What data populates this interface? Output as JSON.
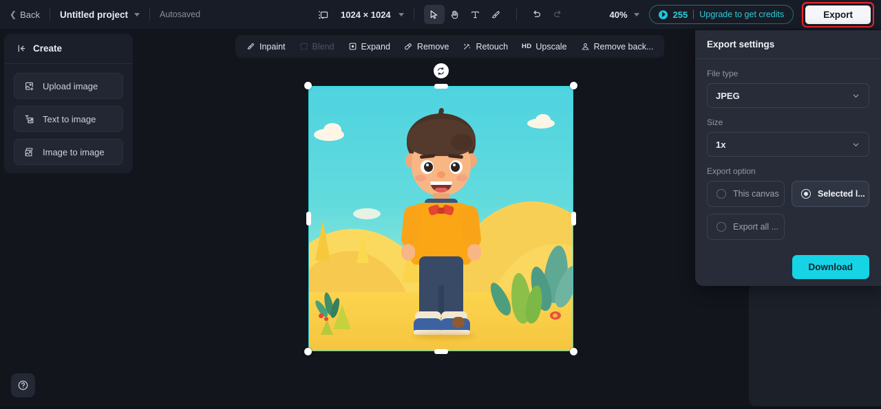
{
  "topbar": {
    "back_label": "Back",
    "back_icon": "chevron-left-icon",
    "project_name": "Untitled project",
    "project_caret_icon": "chevron-down-icon",
    "autosaved_label": "Autosaved",
    "canvas_icon": "canvas-frame-icon",
    "canvas_dimensions": "1024 × 1024",
    "dimensions_caret_icon": "chevron-down-icon",
    "tools": [
      {
        "name": "select-tool",
        "icon": "cursor-arrow-icon",
        "selected": true
      },
      {
        "name": "hand-tool",
        "icon": "hand-icon",
        "selected": false
      },
      {
        "name": "text-tool",
        "icon": "text-t-icon",
        "selected": false
      },
      {
        "name": "brush-tool",
        "icon": "brush-icon",
        "selected": false
      },
      {
        "name": "undo-tool",
        "icon": "undo-arrow-icon",
        "selected": false
      },
      {
        "name": "redo-tool",
        "icon": "redo-arrow-icon",
        "selected": false
      }
    ],
    "zoom_level": "40%",
    "zoom_caret_icon": "chevron-down-icon",
    "credits_count": "255",
    "credits_icon": "coin-icon",
    "upgrade_label": "Upgrade to get credits",
    "export_label": "Export",
    "highlight_color": "#f4262b",
    "accent_color": "#2ecad9"
  },
  "sidebar": {
    "collapse_icon": "collapse-left-icon",
    "title": "Create",
    "items": [
      {
        "label": "Upload image",
        "icon": "upload-image-icon"
      },
      {
        "label": "Text to image",
        "icon": "text-to-image-icon"
      },
      {
        "label": "Image to image",
        "icon": "image-to-image-icon"
      }
    ]
  },
  "toolbar": {
    "items": [
      {
        "label": "Inpaint",
        "icon": "inpaint-brush-icon",
        "disabled": false
      },
      {
        "label": "Blend",
        "icon": "blend-icon",
        "disabled": true
      },
      {
        "label": "Expand",
        "icon": "expand-icon",
        "disabled": false
      },
      {
        "label": "Remove",
        "icon": "eraser-icon",
        "disabled": false
      },
      {
        "label": "Retouch",
        "icon": "retouch-wand-icon",
        "disabled": false
      },
      {
        "label": "Upscale",
        "icon": "hd-icon",
        "disabled": false
      },
      {
        "label": "Remove back...",
        "icon": "remove-background-icon",
        "disabled": false
      }
    ]
  },
  "canvas": {
    "rotate_icon": "rotate-icon",
    "selection_color": "#2fd0d8",
    "artwork_description": "3D cartoon boy in orange shirt and blue jeans standing on yellow dunes"
  },
  "export_panel": {
    "title": "Export settings",
    "file_type_label": "File type",
    "file_type_value": "JPEG",
    "size_label": "Size",
    "size_value": "1x",
    "export_option_label": "Export option",
    "options": [
      {
        "label": "This canvas",
        "selected": false
      },
      {
        "label": "Selected l...",
        "selected": true
      },
      {
        "label": "Export all ...",
        "selected": false
      }
    ],
    "download_label": "Download",
    "download_color": "#17d3e6"
  },
  "footer": {
    "help_icon": "question-circle-icon"
  }
}
